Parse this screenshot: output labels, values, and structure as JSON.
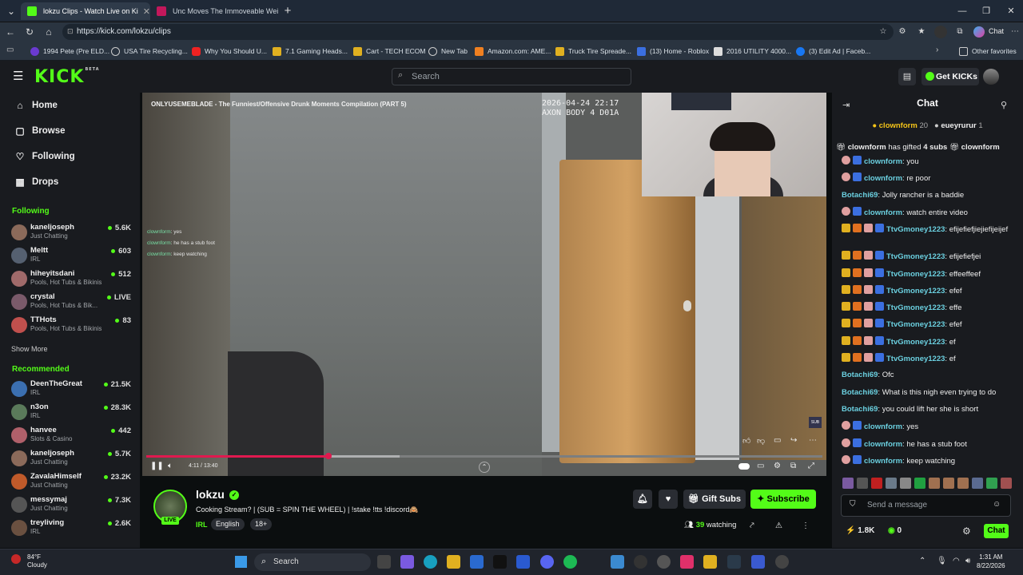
{
  "browser": {
    "tabs": [
      {
        "title": "lokzu Clips - Watch Live on Ki",
        "active": true
      },
      {
        "title": "Unc Moves The Immoveable Weig",
        "active": false
      }
    ],
    "url": "https://kick.com/lokzu/clips",
    "bookmarks": [
      "1994 Pete (Pre ELD...",
      "USA Tire Recycling...",
      "Why You Should U...",
      "7.1 Gaming Heads...",
      "Cart - TECH ECOM",
      "New Tab",
      "Amazon.com: AME...",
      "Truck Tire Spreade...",
      "(13) Home - Roblox",
      "2016 UTILITY 4000...",
      "(3) Edit Ad | Faceb..."
    ],
    "other_favorites": "Other favorites",
    "chat_button": "Chat"
  },
  "kick": {
    "logo": "KICK",
    "logo_beta": "BETA",
    "search_placeholder": "Search",
    "get_kicks": "Get KICKs"
  },
  "sidebar": {
    "nav": [
      "Home",
      "Browse",
      "Following",
      "Drops"
    ],
    "following_header": "Following",
    "following": [
      {
        "name": "kaneljoseph",
        "category": "Just Chatting",
        "viewers": "5.6K",
        "color": "#8b6a5a"
      },
      {
        "name": "Meltt",
        "category": "IRL",
        "viewers": "603",
        "color": "#556070"
      },
      {
        "name": "hiheyitsdani",
        "category": "Pools, Hot Tubs & Bikinis",
        "viewers": "512",
        "color": "#a06a6a"
      },
      {
        "name": "crystal",
        "category": "Pools, Hot Tubs & Bik...",
        "viewers": "LIVE",
        "color": "#7a5a6a"
      },
      {
        "name": "TTHots",
        "category": "Pools, Hot Tubs & Bikinis",
        "viewers": "83",
        "color": "#c0504d"
      }
    ],
    "show_more": "Show More",
    "recommended_header": "Recommended",
    "recommended": [
      {
        "name": "DeenTheGreat",
        "category": "IRL",
        "viewers": "21.5K",
        "color": "#3b6fb0"
      },
      {
        "name": "n3on",
        "category": "IRL",
        "viewers": "28.3K",
        "color": "#5a7a5a"
      },
      {
        "name": "hanvee",
        "category": "Slots & Casino",
        "viewers": "442",
        "color": "#b0606a"
      },
      {
        "name": "kaneljoseph",
        "category": "Just Chatting",
        "viewers": "5.7K",
        "color": "#8b6a5a"
      },
      {
        "name": "ZavalaHimself",
        "category": "Just Chatting",
        "viewers": "23.2K",
        "color": "#c05a2a"
      },
      {
        "name": "messymaj",
        "category": "Just Chatting",
        "viewers": "7.3K",
        "color": "#555"
      },
      {
        "name": "treyliving",
        "category": "IRL",
        "viewers": "2.6K",
        "color": "#6a5040"
      }
    ]
  },
  "video": {
    "title": "ONLYUSEMEBLADE - The Funniest/Offensive Drunk Moments Compilation (PART 5)",
    "stamp_line1": "2026-04-24 22:17",
    "stamp_line2": "AXON BODY 4 D01A",
    "overlay_chat": [
      {
        "user": "clownform",
        "text": "yes"
      },
      {
        "user": "clownform",
        "text": "he has a stub foot"
      },
      {
        "user": "clownform",
        "text": "keep watching"
      }
    ],
    "time": "4:11 / 13:40",
    "progress_fraction": 0.27
  },
  "stream": {
    "name": "lokzu",
    "live": "LIVE",
    "title": "Cooking Stream? | (SUB = SPIN THE WHEEL) | !stake !tts !discord🙈",
    "category": "IRL",
    "tags": [
      "English",
      "18+"
    ],
    "gift_subs": "Gift Subs",
    "subscribe": "Subscribe",
    "viewers": "39",
    "watching": "watching"
  },
  "chat": {
    "title": "Chat",
    "gifter1": "clownform",
    "gifter1_count": "20",
    "gifter2": "eueyrurur",
    "gifter2_count": "1",
    "gift_banner_user": "clownform",
    "gift_banner_text": "has gifted",
    "gift_banner_count": "4 subs",
    "gift_banner_tail": "clownform",
    "messages": [
      {
        "user": "clownform",
        "text": "you",
        "color": "#6bd0e0",
        "badges": 2
      },
      {
        "user": "clownform",
        "text": "re poor",
        "color": "#6bd0e0",
        "badges": 2
      },
      {
        "user": "Botachi69",
        "text": "Jolly rancher is a baddie",
        "color": "#6bd0e0",
        "badges": 0
      },
      {
        "user": "clownform",
        "text": "watch entire video",
        "color": "#6bd0e0",
        "badges": 2
      },
      {
        "user": "TtvGmoney1223",
        "text": "efijefiefjiejiefijeijef",
        "color": "#6bd0e0",
        "badges": 4
      },
      {
        "user": "TtvGmoney1223",
        "text": "efijefiefjei",
        "color": "#6bd0e0",
        "badges": 4
      },
      {
        "user": "TtvGmoney1223",
        "text": "effeeffeef",
        "color": "#6bd0e0",
        "badges": 4
      },
      {
        "user": "TtvGmoney1223",
        "text": "efef",
        "color": "#6bd0e0",
        "badges": 4
      },
      {
        "user": "TtvGmoney1223",
        "text": "effe",
        "color": "#6bd0e0",
        "badges": 4
      },
      {
        "user": "TtvGmoney1223",
        "text": "efef",
        "color": "#6bd0e0",
        "badges": 4
      },
      {
        "user": "TtvGmoney1223",
        "text": "ef",
        "color": "#6bd0e0",
        "badges": 4
      },
      {
        "user": "TtvGmoney1223",
        "text": "ef",
        "color": "#6bd0e0",
        "badges": 4
      },
      {
        "user": "Botachi69",
        "text": "Ofc",
        "color": "#6bd0e0",
        "badges": 0
      },
      {
        "user": "Botachi69",
        "text": "What is this nigh even trying to do",
        "color": "#6bd0e0",
        "badges": 0
      },
      {
        "user": "Botachi69",
        "text": "you could lift her she is short",
        "color": "#6bd0e0",
        "badges": 0
      },
      {
        "user": "clownform",
        "text": "yes",
        "color": "#6bd0e0",
        "badges": 2
      },
      {
        "user": "clownform",
        "text": "he has a stub foot",
        "color": "#6bd0e0",
        "badges": 2
      },
      {
        "user": "clownform",
        "text": "keep watching",
        "color": "#6bd0e0",
        "badges": 2
      }
    ],
    "input_placeholder": "Send a message",
    "kicks": "1.8K",
    "points": "0",
    "send_label": "Chat"
  },
  "taskbar": {
    "temp": "84°F",
    "weather": "Cloudy",
    "search": "Search",
    "time": "1:31 AM",
    "date": "8/22/2026"
  },
  "colors": {
    "accent": "#53fc18",
    "progress": "#e0194f"
  }
}
